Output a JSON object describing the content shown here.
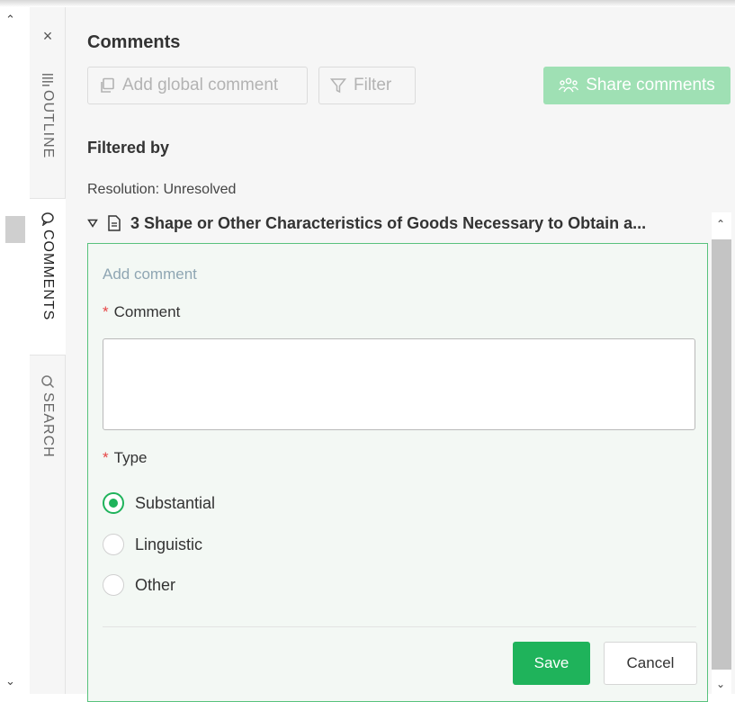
{
  "rail": {
    "close_glyph": "×",
    "tabs": [
      {
        "label": "OUTLINE",
        "icon": "outline-icon"
      },
      {
        "label": "COMMENTS",
        "icon": "comment-bubble-icon"
      },
      {
        "label": "SEARCH",
        "icon": "search-icon"
      }
    ]
  },
  "panel": {
    "title": "Comments",
    "add_global_label": "Add global comment",
    "filter_label": "Filter",
    "share_label": "Share comments",
    "filtered_by": "Filtered by",
    "resolution": "Resolution: Unresolved",
    "section_title": "3 Shape or Other Characteristics of Goods Necessary to Obtain a..."
  },
  "card": {
    "hint": "Add comment",
    "comment_label": "Comment",
    "required_mark": "*",
    "comment_value": "",
    "type_label": "Type",
    "options": [
      "Substantial",
      "Linguistic",
      "Other"
    ],
    "selected": "Substantial",
    "save_label": "Save",
    "cancel_label": "Cancel"
  },
  "colors": {
    "accent_green": "#1fb35b",
    "share_green_disabled": "#9fe0b4",
    "required_red": "#e64545",
    "card_border": "#58c27d"
  }
}
